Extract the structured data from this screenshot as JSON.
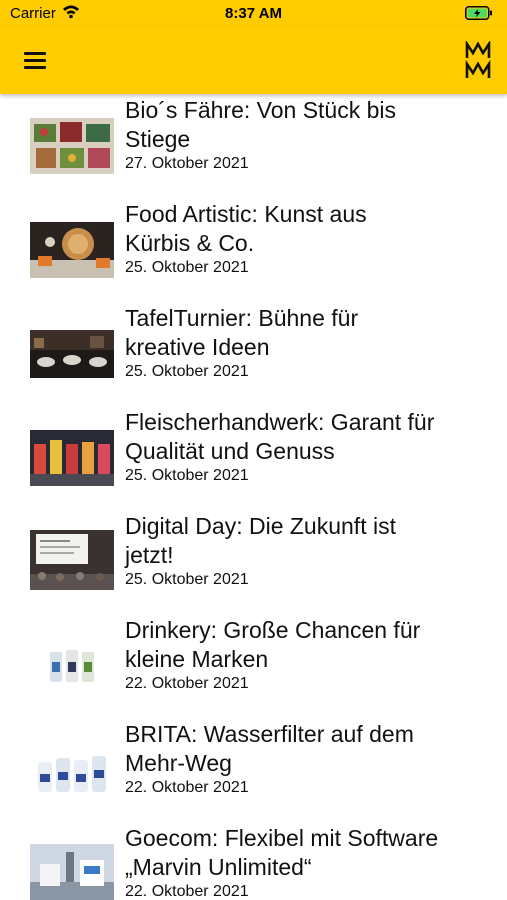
{
  "status_bar": {
    "carrier": "Carrier",
    "time": "8:37 AM"
  },
  "header": {
    "menu_icon": "hamburger-icon",
    "logo_icon": "mm-logo-icon",
    "accent_color": "#ffcc00"
  },
  "articles": [
    {
      "title_line1": "Bio´s Fähre: Von Stück bis",
      "title_line2": "Stiege",
      "date": "27. Oktober 2021"
    },
    {
      "title_line1": "Food Artistic: Kunst aus",
      "title_line2": "Kürbis & Co.",
      "date": "25. Oktober 2021"
    },
    {
      "title_line1": "TafelTurnier: Bühne für",
      "title_line2": "kreative Ideen",
      "date": "25. Oktober 2021"
    },
    {
      "title_line1": "Fleischerhandwerk: Garant für",
      "title_line2": "Qualität und Genuss",
      "date": "25. Oktober 2021"
    },
    {
      "title_line1": "Digital Day: Die Zukunft ist",
      "title_line2": "jetzt!",
      "date": "25. Oktober 2021"
    },
    {
      "title_line1": "Drinkery: Große Chancen für",
      "title_line2": "kleine Marken",
      "date": "22. Oktober 2021"
    },
    {
      "title_line1": "BRITA: Wasserfilter auf dem",
      "title_line2": "Mehr-Weg",
      "date": "22. Oktober 2021"
    },
    {
      "title_line1": "Goecom: Flexibel mit Software",
      "title_line2": "„Marvin Unlimited“",
      "date": "22. Oktober 2021"
    }
  ]
}
